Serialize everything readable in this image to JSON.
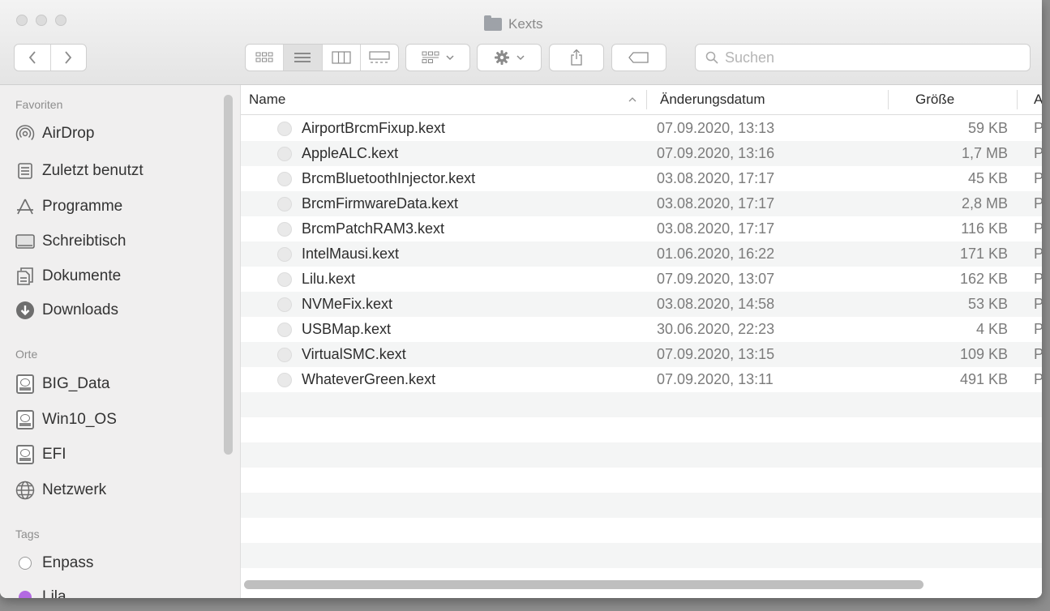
{
  "window": {
    "title": "Kexts"
  },
  "toolbar": {
    "search_placeholder": "Suchen"
  },
  "sidebar": {
    "sections": [
      {
        "heading": "Favoriten",
        "items": [
          {
            "label": "AirDrop",
            "icon": "airdrop-icon"
          },
          {
            "label": "Zuletzt benutzt",
            "icon": "recents-icon"
          },
          {
            "label": "Programme",
            "icon": "applications-icon"
          },
          {
            "label": "Schreibtisch",
            "icon": "desktop-icon"
          },
          {
            "label": "Dokumente",
            "icon": "documents-icon"
          },
          {
            "label": "Downloads",
            "icon": "downloads-icon"
          }
        ]
      },
      {
        "heading": "Orte",
        "items": [
          {
            "label": "BIG_Data",
            "icon": "disk-icon"
          },
          {
            "label": "Win10_OS",
            "icon": "disk-icon"
          },
          {
            "label": "EFI",
            "icon": "disk-icon"
          },
          {
            "label": "Netzwerk",
            "icon": "network-icon"
          }
        ]
      },
      {
        "heading": "Tags",
        "items": [
          {
            "label": "Enpass",
            "icon": "tag-icon",
            "color": "#ffffff"
          },
          {
            "label": "Lila",
            "icon": "tag-icon",
            "color": "#b36ae2"
          }
        ]
      }
    ]
  },
  "list": {
    "columns": {
      "name": "Name",
      "date": "Änderungsdatum",
      "size": "Größe",
      "kind": "A"
    },
    "rows": [
      {
        "name": "AirportBrcmFixup.kext",
        "date": "07.09.2020, 13:13",
        "size": "59 KB",
        "kind": "P"
      },
      {
        "name": "AppleALC.kext",
        "date": "07.09.2020, 13:16",
        "size": "1,7 MB",
        "kind": "P"
      },
      {
        "name": "BrcmBluetoothInjector.kext",
        "date": "03.08.2020, 17:17",
        "size": "45 KB",
        "kind": "P"
      },
      {
        "name": "BrcmFirmwareData.kext",
        "date": "03.08.2020, 17:17",
        "size": "2,8 MB",
        "kind": "P"
      },
      {
        "name": "BrcmPatchRAM3.kext",
        "date": "03.08.2020, 17:17",
        "size": "116 KB",
        "kind": "P"
      },
      {
        "name": "IntelMausi.kext",
        "date": "01.06.2020, 16:22",
        "size": "171 KB",
        "kind": "P"
      },
      {
        "name": "Lilu.kext",
        "date": "07.09.2020, 13:07",
        "size": "162 KB",
        "kind": "P"
      },
      {
        "name": "NVMeFix.kext",
        "date": "03.08.2020, 14:58",
        "size": "53 KB",
        "kind": "P"
      },
      {
        "name": "USBMap.kext",
        "date": "30.06.2020, 22:23",
        "size": "4 KB",
        "kind": "P"
      },
      {
        "name": "VirtualSMC.kext",
        "date": "07.09.2020, 13:15",
        "size": "109 KB",
        "kind": "P"
      },
      {
        "name": "WhateverGreen.kext",
        "date": "07.09.2020, 13:11",
        "size": "491 KB",
        "kind": "P"
      }
    ]
  }
}
